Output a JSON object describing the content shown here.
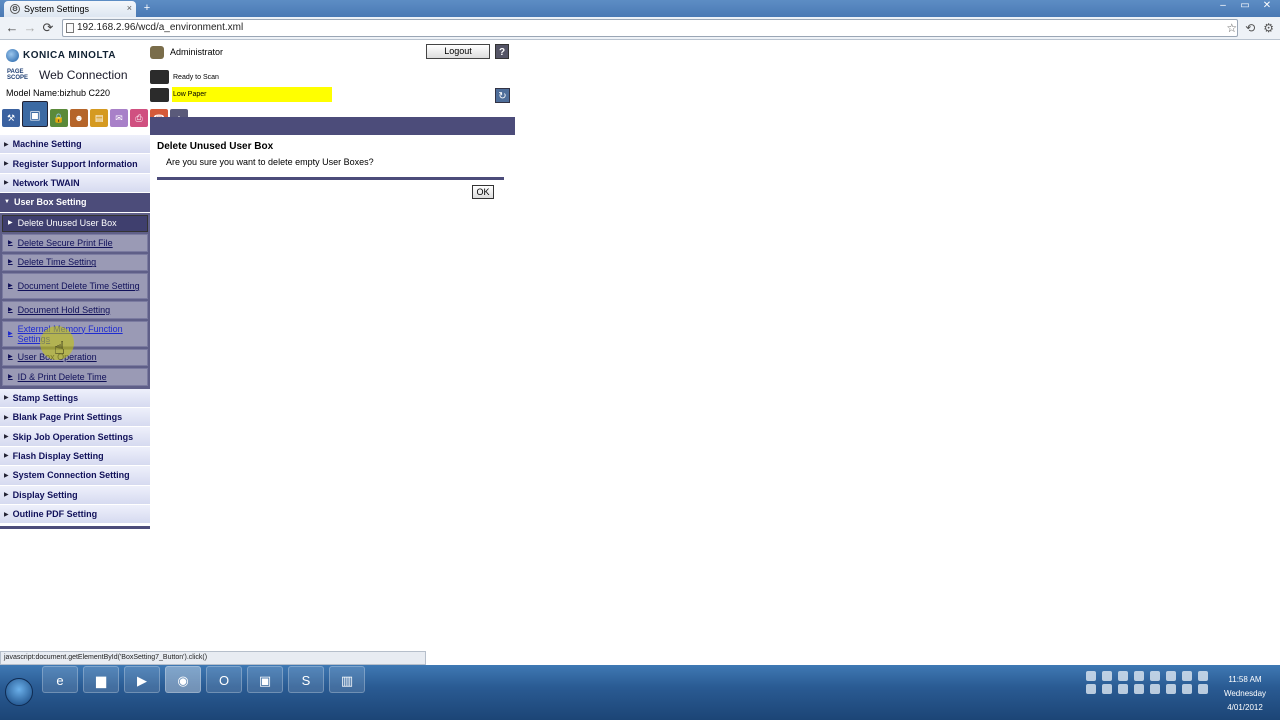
{
  "browser": {
    "tab_title": "System Settings",
    "tab_close": "×",
    "new_tab": "+",
    "url": "192.168.2.96/wcd/a_environment.xml",
    "back": "←",
    "forward": "→",
    "reload": "⟳",
    "bookmark_star": "☆",
    "window_buttons": [
      "–",
      "▭",
      "✕"
    ],
    "status_url": "javascript:document.getElementById('BoxSetting7_Button').click()"
  },
  "header": {
    "brand": "KONICA MINOLTA",
    "pagescope_logo": "PAGE SCOPE",
    "web_connection": "Web Connection",
    "model": "Model Name:bizhub C220",
    "user": "Administrator",
    "logout": "Logout",
    "help": "?",
    "status_ready": "Ready to Scan",
    "status_low_paper": "Low Paper",
    "refresh_icon": "↻"
  },
  "mode_icons": [
    {
      "name": "maintenance-icon",
      "glyph": "⚒",
      "color": "#3b62a0"
    },
    {
      "name": "system-settings-icon",
      "glyph": "▣",
      "color": "#3c6aa3",
      "active": true
    },
    {
      "name": "security-icon",
      "glyph": "🔒",
      "color": "#5a8a3a"
    },
    {
      "name": "user-auth-icon",
      "glyph": "☻",
      "color": "#b5652a"
    },
    {
      "name": "network-icon",
      "glyph": "▤",
      "color": "#d59a20"
    },
    {
      "name": "box-icon",
      "glyph": "✉",
      "color": "#a880c8"
    },
    {
      "name": "print-setting-icon",
      "glyph": "⎙",
      "color": "#d05080"
    },
    {
      "name": "store-address-icon",
      "glyph": "☎",
      "color": "#d65a3a"
    },
    {
      "name": "wizard-icon",
      "glyph": "⌂",
      "color": "#5a5a7a"
    }
  ],
  "sidebar": {
    "items_before": [
      {
        "label": "Machine Setting"
      },
      {
        "label": "Register Support Information"
      },
      {
        "label": "Network TWAIN"
      }
    ],
    "open_item": {
      "label": "User Box Setting"
    },
    "sub_items": [
      {
        "label": "Delete Unused User Box",
        "current": true
      },
      {
        "label": "Delete Secure Print File"
      },
      {
        "label": "Delete Time Setting"
      },
      {
        "label": "Document Delete Time Setting",
        "two": true
      },
      {
        "label": "Document Hold Setting"
      },
      {
        "label": "External Memory Function Settings",
        "two": true,
        "hover": true
      },
      {
        "label": "User Box Operation"
      },
      {
        "label": "ID & Print Delete Time"
      }
    ],
    "items_after": [
      {
        "label": "Stamp Settings"
      },
      {
        "label": "Blank Page Print Settings"
      },
      {
        "label": "Skip Job Operation Settings"
      },
      {
        "label": "Flash Display Setting"
      },
      {
        "label": "System Connection Setting"
      },
      {
        "label": "Display Setting"
      },
      {
        "label": "Outline PDF Setting"
      }
    ]
  },
  "main": {
    "title": "Delete Unused User Box",
    "message": "Are you sure you want to delete empty User Boxes?",
    "ok": "OK"
  },
  "taskbar": {
    "apps": [
      {
        "name": "internet-explorer-icon",
        "glyph": "e"
      },
      {
        "name": "file-explorer-icon",
        "glyph": "▆"
      },
      {
        "name": "media-player-icon",
        "glyph": "▶"
      },
      {
        "name": "chrome-icon",
        "glyph": "◉",
        "active": true
      },
      {
        "name": "outlook-icon",
        "glyph": "O"
      },
      {
        "name": "app-window-icon",
        "glyph": "▣"
      },
      {
        "name": "skype-icon",
        "glyph": "S"
      },
      {
        "name": "printer-app-icon",
        "glyph": "▥"
      }
    ],
    "clock_time": "11:58 AM",
    "clock_day": "Wednesday",
    "clock_date": "4/01/2012"
  }
}
